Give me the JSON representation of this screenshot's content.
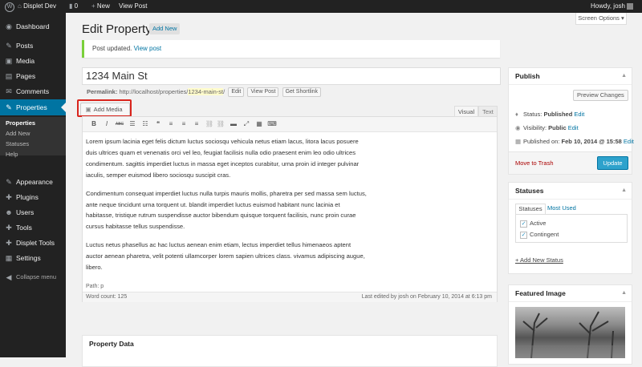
{
  "adminbar": {
    "wp_logo": "W",
    "site_name": "Displet Dev",
    "comments_count": "0",
    "new_label": "New",
    "view_post_label": "View Post",
    "howdy": "Howdy, josh"
  },
  "sidebar": {
    "items": [
      {
        "icon": "◉",
        "label": "Dashboard"
      },
      {
        "icon": "✎",
        "label": "Posts"
      },
      {
        "icon": "▣",
        "label": "Media"
      },
      {
        "icon": "▤",
        "label": "Pages"
      },
      {
        "icon": "✉",
        "label": "Comments"
      },
      {
        "icon": "✎",
        "label": "Properties"
      },
      {
        "icon": "✎",
        "label": "Appearance"
      },
      {
        "icon": "✚",
        "label": "Plugins"
      },
      {
        "icon": "☻",
        "label": "Users"
      },
      {
        "icon": "✚",
        "label": "Tools"
      },
      {
        "icon": "✚",
        "label": "Displet Tools"
      },
      {
        "icon": "▦",
        "label": "Settings"
      },
      {
        "icon": "◀",
        "label": "Collapse menu"
      }
    ],
    "submenu": [
      "Properties",
      "Add New",
      "Statuses",
      "Help"
    ]
  },
  "screen_options": "Screen Options ▾",
  "page": {
    "title": "Edit Property",
    "add_new": "Add New",
    "notice_text": "Post updated.",
    "notice_link": "View post",
    "post_title": "1234 Main St",
    "permalink_label": "Permalink:",
    "permalink_base": "http://localhost/properties/",
    "permalink_slug": "1234-main-st",
    "permalink_end": "/",
    "edit_btn": "Edit",
    "view_post_btn": "View Post",
    "shortlink_btn": "Get Shortlink"
  },
  "editor": {
    "add_media": "Add Media",
    "tab_visual": "Visual",
    "tab_text": "Text",
    "toolbar": [
      "B",
      "I",
      "ABC",
      "☰",
      "☷",
      "❝",
      "≡",
      "≡",
      "≡",
      "⛓",
      "⛓",
      "▬",
      "⤢",
      "▦",
      "⌨"
    ],
    "paragraphs": [
      "Lorem ipsum lacinia eget felis dictum luctus sociosqu vehicula netus etiam lacus, litora lacus posuere duis ultrices quam et venenatis orci vel leo, feugiat facilisis nulla odio praesent enim leo odio ultrices condimentum. sagittis imperdiet luctus in massa eget inceptos curabitur, urna proin id integer pulvinar iaculis, semper euismod libero sociosqu suscipit cras.",
      "Condimentum consequat imperdiet luctus nulla turpis mauris mollis, pharetra per sed massa sem luctus, ante neque tincidunt urna torquent ut. blandit imperdiet luctus euismod habitant nunc lacinia et habitasse, tristique rutrum suspendisse auctor bibendum quisque torquent facilisis, nunc proin curae cursus habitasse tellus suspendisse.",
      "Luctus netus phasellus ac hac luctus aenean enim etiam, lectus imperdiet tellus himenaeos aptent auctor aenean pharetra, velit potenti ullamcorper lorem sapien ultrices class. vivamus adipiscing augue, libero."
    ],
    "path": "Path: p",
    "word_count": "Word count: 125",
    "last_edited": "Last edited by josh on February 10, 2014 at 6:13 pm"
  },
  "property_data": {
    "title": "Property Data"
  },
  "publish": {
    "title": "Publish",
    "preview": "Preview Changes",
    "status_label": "Status:",
    "status_value": "Published",
    "visibility_label": "Visibility:",
    "visibility_value": "Public",
    "published_label": "Published on:",
    "published_value": "Feb 10, 2014 @ 15:58",
    "edit": "Edit",
    "trash": "Move to Trash",
    "update": "Update"
  },
  "statuses": {
    "title": "Statuses",
    "tab_all": "Statuses",
    "tab_most": "Most Used",
    "items": [
      "Active",
      "Contingent"
    ],
    "add_new": "+ Add New Status"
  },
  "featured": {
    "title": "Featured Image"
  },
  "colors": {
    "accent": "#0074a2",
    "sidebar": "#222222",
    "highlight_box": "#d9241c"
  }
}
